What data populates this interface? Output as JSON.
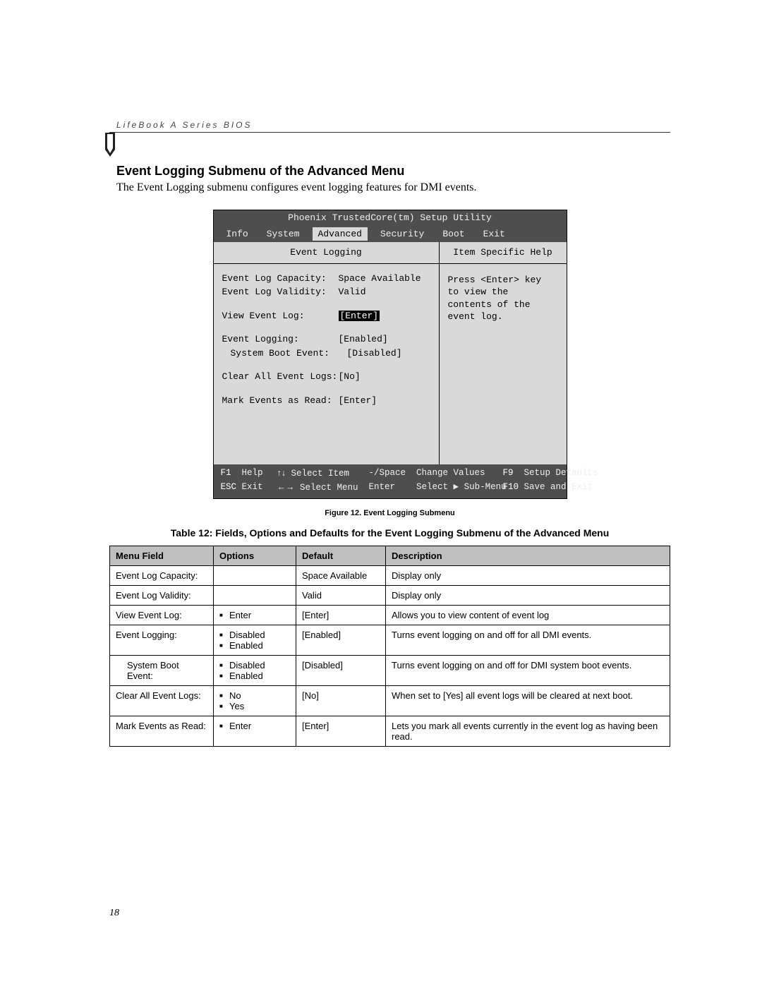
{
  "header": {
    "running": "LifeBook A Series BIOS"
  },
  "section": {
    "title": "Event Logging Submenu of the Advanced Menu",
    "intro": "The Event Logging submenu configures event logging features for DMI events."
  },
  "bios": {
    "title": "Phoenix TrustedCore(tm) Setup Utility",
    "tabs": [
      "Info",
      "System",
      "Advanced",
      "Security",
      "Boot",
      "Exit"
    ],
    "active_tab": "Advanced",
    "subhead_left": "Event Logging",
    "subhead_right": "Item Specific Help",
    "help_text": "Press <Enter> key to view the contents of the event log.",
    "rows": [
      {
        "label": "Event Log Capacity:",
        "value": "Space Available",
        "sel": false
      },
      {
        "label": "Event Log Validity:",
        "value": "Valid",
        "sel": false
      },
      {
        "label": "View Event Log:",
        "value": "[Enter]",
        "sel": true,
        "gap_before": true
      },
      {
        "label": "Event Logging:",
        "value": "[Enabled]",
        "sel": false,
        "gap_before": true
      },
      {
        "label": "System Boot Event:",
        "value": "[Disabled]",
        "sel": false,
        "indent": true
      },
      {
        "label": "Clear All Event Logs:",
        "value": "[No]",
        "sel": false,
        "gap_before": true
      },
      {
        "label": "Mark Events as Read:",
        "value": "[Enter]",
        "sel": false,
        "gap_before": true
      }
    ],
    "footer": {
      "f1": "Help",
      "esc": "Exit",
      "select_item": "Select Item",
      "select_menu": "Select Menu",
      "change_values": "Change Values",
      "sub_menu": "Select ▶ Sub-Menu",
      "minus_space": "-/Space",
      "enter": "Enter",
      "f9": "Setup Defaults",
      "f10": "Save and Exit"
    }
  },
  "figure_caption": "Figure 12.  Event Logging Submenu",
  "table_title": "Table 12: Fields, Options and Defaults for the Event Logging Submenu of the Advanced Menu",
  "table": {
    "headers": [
      "Menu Field",
      "Options",
      "Default",
      "Description"
    ],
    "rows": [
      {
        "field": "Event Log Capacity:",
        "options": [],
        "default": "Space Available",
        "desc": "Display only"
      },
      {
        "field": "Event Log Validity:",
        "options": [],
        "default": "Valid",
        "desc": "Display only"
      },
      {
        "field": "View Event Log:",
        "options": [
          "Enter"
        ],
        "default": "[Enter]",
        "desc": "Allows you to view content of event log"
      },
      {
        "field": "Event Logging:",
        "options": [
          "Disabled",
          "Enabled"
        ],
        "default": "[Enabled]",
        "desc": "Turns event logging on and off for all DMI events."
      },
      {
        "field": "System Boot Event:",
        "indent": true,
        "options": [
          "Disabled",
          "Enabled"
        ],
        "default": "[Disabled]",
        "desc": "Turns event logging on and off for DMI system boot events."
      },
      {
        "field": "Clear All Event Logs:",
        "options": [
          "No",
          "Yes"
        ],
        "default": "[No]",
        "desc": "When set to [Yes] all event logs will be cleared at next boot."
      },
      {
        "field": "Mark Events as Read:",
        "options": [
          "Enter"
        ],
        "default": "[Enter]",
        "desc": "Lets you mark all events currently in the event log as having been read."
      }
    ]
  },
  "page_number": "18"
}
